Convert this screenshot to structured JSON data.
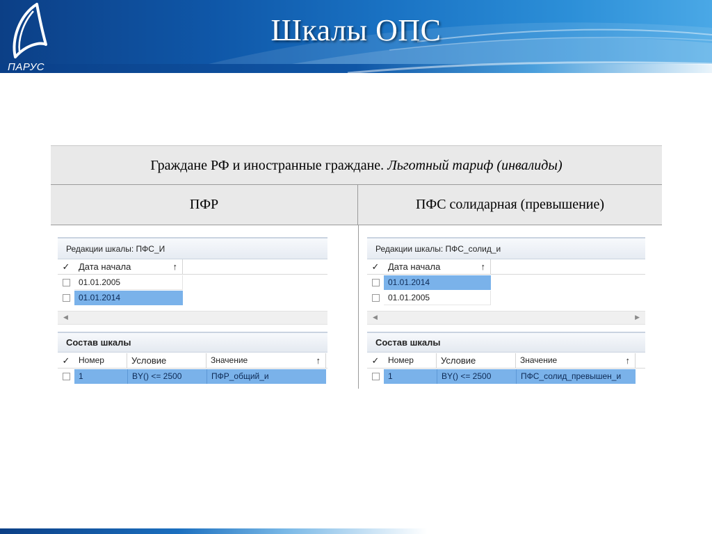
{
  "header": {
    "title": "Шкалы ОПС",
    "logo_text": "ПАРУС"
  },
  "comparison": {
    "caption_normal": "Граждане РФ и иностранные граждане.",
    "caption_italic": "Льготный тариф (инвалиды)",
    "col_left": "ПФР",
    "col_right": "ПФС солидарная (превышение)"
  },
  "panel_pfr": {
    "title": "Редакции шкалы: ПФС_И",
    "versions_header": {
      "check": "✓",
      "date": "Дата начала",
      "sort": "↑"
    },
    "versions": [
      {
        "date": "01.01.2005",
        "selected": false
      },
      {
        "date": "01.01.2014",
        "selected": true
      }
    ],
    "scroll_left": "◀",
    "composition_title": "Состав шкалы",
    "composition_header": {
      "check": "✓",
      "number": "Номер",
      "condition": "Условие",
      "value": "Значение",
      "sort": "↑"
    },
    "composition_rows": [
      {
        "number": "1",
        "condition": "BY() <= 2500",
        "value": "ПФР_общий_и"
      }
    ]
  },
  "panel_pfs": {
    "title": "Редакции шкалы: ПФС_солид_и",
    "versions_header": {
      "check": "✓",
      "date": "Дата начала",
      "sort": "↑"
    },
    "versions": [
      {
        "date": "01.01.2014",
        "selected": true
      },
      {
        "date": "01.01.2005",
        "selected": false
      }
    ],
    "scroll_left": "◀",
    "scroll_right": "▶",
    "composition_title": "Состав шкалы",
    "composition_header": {
      "check": "✓",
      "number": "Номер",
      "condition": "Условие",
      "value": "Значение",
      "sort": "↑"
    },
    "composition_rows": [
      {
        "number": "1",
        "condition": "BY() <= 2500",
        "value": "ПФС_солид_превышен_и"
      }
    ]
  },
  "colors": {
    "banner_dark": "#0c3f86",
    "banner_light": "#4aa8e6",
    "selection": "#7ab2ea",
    "panel_header_bg": "#e9e9e9"
  }
}
